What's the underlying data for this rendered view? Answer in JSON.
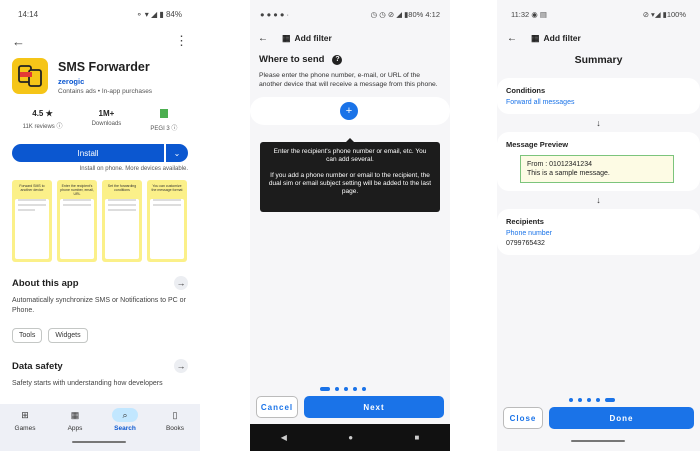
{
  "phone1": {
    "status": {
      "time": "14:14",
      "battery": "84%"
    },
    "app": {
      "title": "SMS Forwarder",
      "developer": "zerogic",
      "sub": "Contains ads • In-app purchases",
      "icon_text": "SMS"
    },
    "stats": [
      {
        "value": "4.5 ★",
        "label": "11K reviews ⓘ"
      },
      {
        "value": "1M+",
        "label": "Downloads"
      },
      {
        "value": "",
        "label": "PEGI 3 ⓘ"
      }
    ],
    "install_label": "Install",
    "install_note": "Install on phone. More devices available.",
    "screenshots": [
      {
        "caption": "Forward SMS to another device"
      },
      {
        "caption": "Enter the recipient's phone number, email, URL"
      },
      {
        "caption": "Set the forwarding conditions"
      },
      {
        "caption": "You can customize the message format"
      }
    ],
    "about": {
      "title": "About this app",
      "desc": "Automatically synchronize SMS or Notifications to PC or Phone."
    },
    "chips": [
      "Tools",
      "Widgets"
    ],
    "safety": {
      "title": "Data safety",
      "desc": "Safety starts with understanding how developers"
    },
    "nav": [
      {
        "icon": "games-icon",
        "label": "Games"
      },
      {
        "icon": "apps-icon",
        "label": "Apps"
      },
      {
        "icon": "search-icon",
        "label": "Search"
      },
      {
        "icon": "books-icon",
        "label": "Books"
      }
    ]
  },
  "phone2": {
    "status": {
      "battery": "80%",
      "time": "4:12"
    },
    "header": "Add filter",
    "section_title": "Where to send",
    "description": "Please enter the phone number, e-mail, or URL of the another device that will receive a message from this phone.",
    "tooltip": {
      "line1": "Enter the recipient's phone number or email, etc. You can add several.",
      "line2": "If you add a phone number or email to the recipient, the dual sim or email subject setting will be added to the last page."
    },
    "cancel_label": "Cancel",
    "next_label": "Next"
  },
  "phone3": {
    "status": {
      "time": "11:32",
      "battery": "100%"
    },
    "header": "Add filter",
    "title": "Summary",
    "conditions": {
      "title": "Conditions",
      "value": "Forward all messages"
    },
    "preview": {
      "title": "Message Preview",
      "line1": "From : 01012341234",
      "line2": "This is a sample message."
    },
    "recipients": {
      "title": "Recipients",
      "type": "Phone number",
      "value": "0799765432"
    },
    "close_label": "Close",
    "done_label": "Done"
  },
  "colors": {
    "accent": "#1a73e8",
    "play_blue": "#0b57d0",
    "app_icon": "#f5c518"
  }
}
